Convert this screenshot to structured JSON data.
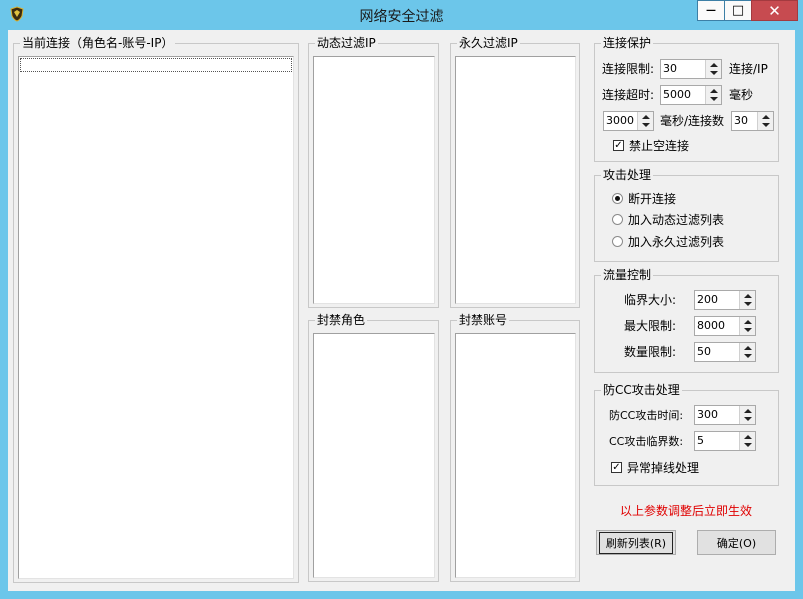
{
  "window": {
    "title": "网络安全过滤",
    "min_glyph": "—",
    "max_glyph": "□",
    "close_glyph": "✕"
  },
  "lists": {
    "current": "当前连接（角色名-账号-IP）",
    "dynamic": "动态过滤IP",
    "permanent": "永久过滤IP",
    "banned_roles": "封禁角色",
    "banned_accounts": "封禁账号"
  },
  "connection": {
    "title": "连接保护",
    "limit_label": "连接限制:",
    "limit_value": "30",
    "limit_unit": "连接/IP",
    "timeout_label": "连接超时:",
    "timeout_value": "5000",
    "timeout_unit": "毫秒",
    "rate_ms_value": "3000",
    "rate_label": "毫秒/连接数",
    "rate_count_value": "30",
    "no_empty_label": "禁止空连接",
    "no_empty_checked": true
  },
  "attack": {
    "title": "攻击处理",
    "options": [
      "断开连接",
      "加入动态过滤列表",
      "加入永久过滤列表"
    ],
    "selected": 0
  },
  "traffic": {
    "title": "流量控制",
    "threshold_label": "临界大小:",
    "threshold_value": "200",
    "max_label": "最大限制:",
    "max_value": "8000",
    "count_label": "数量限制:",
    "count_value": "50"
  },
  "cc": {
    "title": "防CC攻击处理",
    "time_label": "防CC攻击时间:",
    "time_value": "300",
    "threshold_label": "CC攻击临界数:",
    "threshold_value": "5",
    "drop_label": "异常掉线处理",
    "drop_checked": true
  },
  "notice": "以上参数调整后立即生效",
  "buttons": {
    "refresh": "刷新列表(R)",
    "ok": "确定(O)"
  }
}
